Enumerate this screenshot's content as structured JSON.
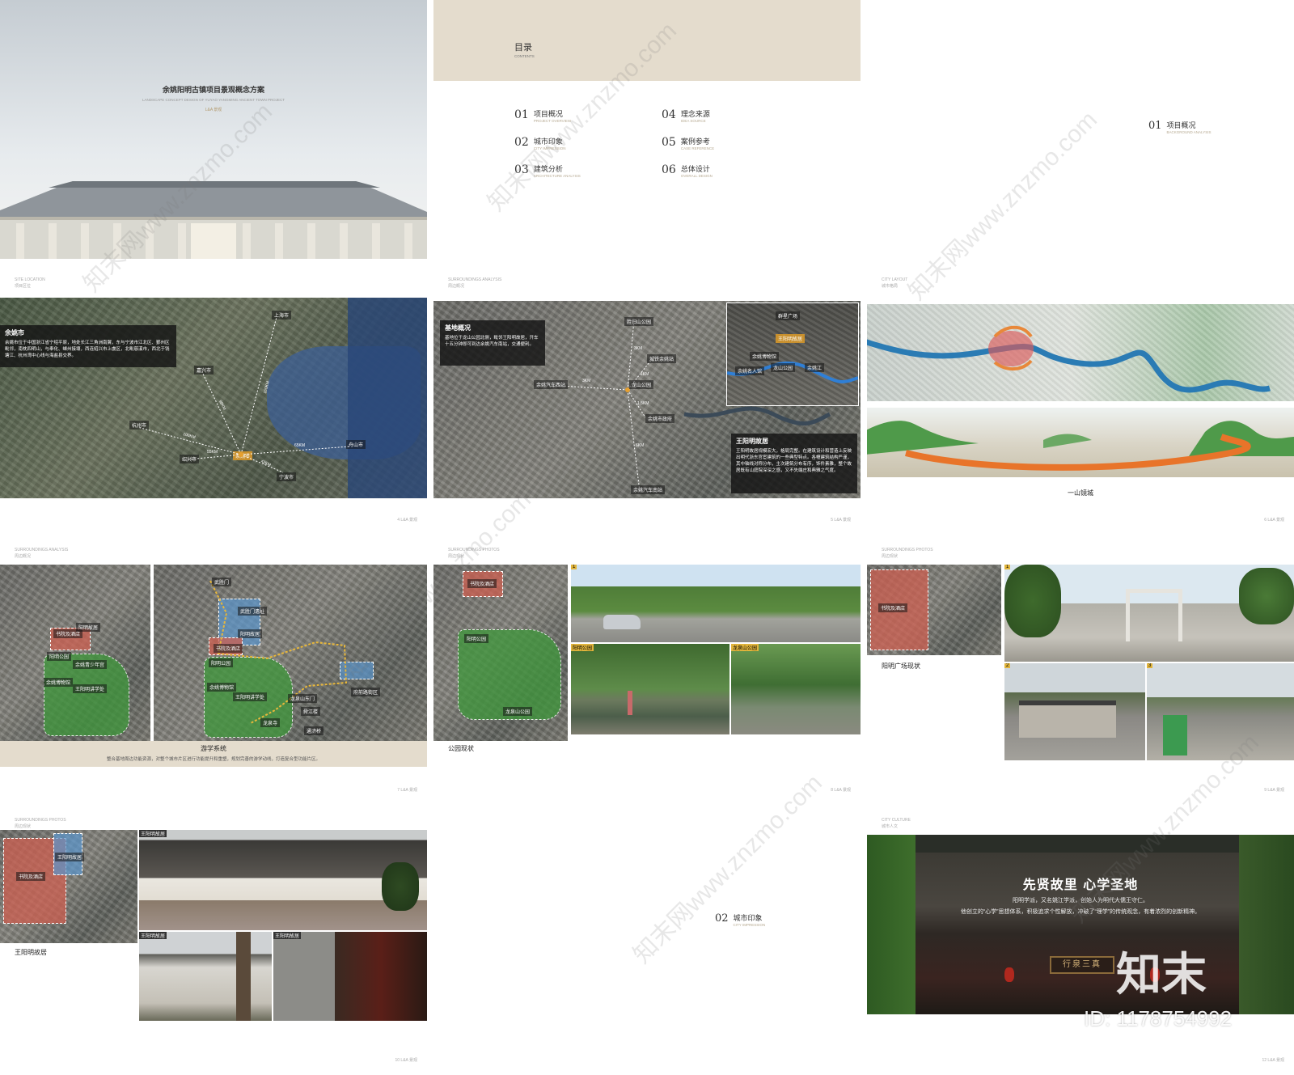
{
  "slide1": {
    "title": "余姚阳明古镇项目景观概念方案",
    "subtitle": "LANDSCAPE CONCEPT DESIGN OF YUYAO YANGMING ANCIENT TOWN PROJECT",
    "brand": "L&A 景观"
  },
  "slide2": {
    "title": "目录",
    "title_en": "CONTENTS",
    "items": [
      {
        "num": "01",
        "zh": "项目概况",
        "en": "PROJECT OVERVIEW"
      },
      {
        "num": "02",
        "zh": "城市印象",
        "en": "CITY IMPRESSION"
      },
      {
        "num": "03",
        "zh": "建筑分析",
        "en": "ARCHITECTURE ANALYSIS"
      },
      {
        "num": "04",
        "zh": "理念来源",
        "en": "IDEA SOURCE"
      },
      {
        "num": "05",
        "zh": "案例参考",
        "en": "CASE REFERENCE"
      },
      {
        "num": "06",
        "zh": "总体设计",
        "en": "OVERALL DESIGN"
      }
    ]
  },
  "slide3": {
    "num": "01",
    "zh": "项目概况",
    "en": "BACKGROUND ANALYSIS"
  },
  "slide4": {
    "hdr_en": "SITE LOCATION",
    "hdr_zh": "项目区位",
    "box_title": "余姚市",
    "box_text": "余姚市位于中国浙江省宁绍平原，地处长江三角洲南翼，东与宁波市江北区、鄞州区毗邻，南枕四明山，与奉化、嵊州接壤，西连绍兴市上虞区，北毗慈溪市，西北于钱塘江、杭州湾中心线与海盐县交界。",
    "cities": [
      "上海市",
      "嘉兴市",
      "杭州市",
      "绍兴市",
      "余姚市",
      "宁波市",
      "舟山市"
    ],
    "distances": [
      "160KM",
      "98KM",
      "100KM",
      "55KM",
      "65KM",
      "42KM"
    ],
    "page": "4  L&A 景观"
  },
  "slide5": {
    "hdr_en": "SURROUNDINGS ANALYSIS",
    "hdr_zh": "周边概况",
    "box_title": "基地概况",
    "box_text": "基地位于龙山公园北侧，毗邻王阳明故居，开车十五分钟即可到达余姚汽车南站，交通便利。",
    "box2_title": "王阳明故居",
    "box2_text": "王阳明故居规模宏大，格局完整。在建筑设计和营造上反映出明代浙东官宦建筑的一些典型特点。各幢建筑结构严谨，其中轴线对称分布，主次建筑分布有序，饰件素雅，整个故居既有山庭院深深之感，又不失端庄和典雅之气度。",
    "labels": [
      "胜归山公园",
      "城铁余姚站",
      "余姚汽车西站",
      "龙山公园",
      "余姚市政府",
      "余姚汽车南站",
      "群星广场",
      "王阳明故居",
      "余姚博物馆",
      "余姚名人馆",
      "龙山公园",
      "余姚江"
    ],
    "distances": [
      "3KM",
      "3KM",
      "1KM",
      "1.5KM",
      "6KM"
    ],
    "page": "5  L&A 景观"
  },
  "slide6": {
    "hdr_en": "CITY LAYOUT",
    "hdr_zh": "城市格局",
    "caption": "一山镜城",
    "page": "6  L&A 景观"
  },
  "slide7": {
    "hdr_en": "SURROUNDINGS ANALYSIS",
    "hdr_zh": "周边概况",
    "caption": "游学系统",
    "caption_text": "整合基地周边功能资源，对整个城市片区进行功能提升和重塑，规划完善的游学动线，打造复合型功能片区。",
    "labels_left": [
      "阳明故居",
      "书院及酒店",
      "阳明公园",
      "余姚博物馆",
      "王阳明讲学处",
      "余姚青少年宫"
    ],
    "labels_right": [
      "武胜门",
      "武胜门遗址",
      "阳明故居",
      "书院及酒店",
      "阳明公园",
      "余姚博物馆",
      "王阳明讲学处",
      "龙泉山东门",
      "府前路街区",
      "舜江楼",
      "龙泉寺",
      "通济桥"
    ],
    "page": "7  L&A 景观"
  },
  "slide8": {
    "hdr_en": "SURROUNDINGS PHOTOS",
    "hdr_zh": "周边现状",
    "caption": "公园现状",
    "labels": [
      "书院及酒店",
      "阳明公园",
      "龙泉山公园"
    ],
    "tags": [
      "1",
      "阳明公园",
      "龙泉山公园"
    ],
    "page": "8  L&A 景观"
  },
  "slide9": {
    "hdr_en": "SURROUNDINGS PHOTOS",
    "hdr_zh": "周边现状",
    "caption": "阳明广场现状",
    "labels": [
      "书院及酒店"
    ],
    "tags": [
      "1",
      "2",
      "3"
    ],
    "page": "9  L&A 景观"
  },
  "slide10": {
    "hdr_en": "SURROUNDINGS PHOTOS",
    "hdr_zh": "周边现状",
    "caption": "王阳明故居",
    "labels": [
      "书院及酒店",
      "王阳明故居"
    ],
    "tags": [
      "王阳明故居",
      "王阳明故居",
      "王阳明故居"
    ],
    "page": "10  L&A 景观"
  },
  "slide11": {
    "num": "02",
    "zh": "城市印象",
    "en": "CITY IMPRESSION"
  },
  "slide12": {
    "hdr_en": "CITY CULTURE",
    "hdr_zh": "城市人文",
    "title": "先贤故里 心学圣地",
    "text1": "阳明学派，又名姚江学派，创始人为明代大儒王守仁。",
    "text2": "他创立的“心学”思想体系，积极追求个性解放，冲破了“理学”的传统观念，有着浓烈的创新精神。",
    "plaque": "行泉三真",
    "page": "12  L&A 景观"
  },
  "watermark": {
    "text": "知末网www.znzmo.com",
    "logo": "知末",
    "id": "ID: 1178754992"
  }
}
